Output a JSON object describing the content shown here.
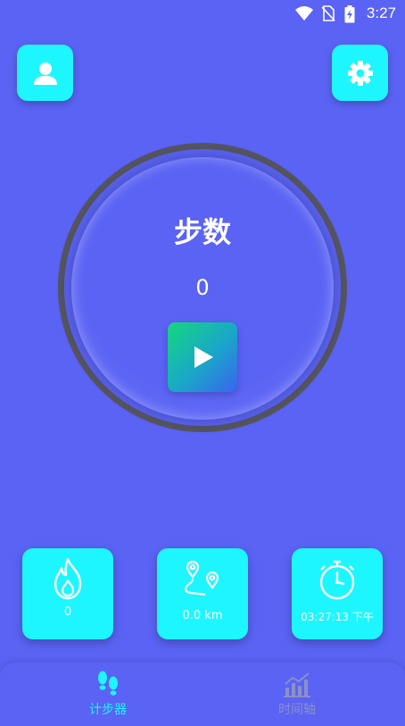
{
  "status_bar": {
    "time": "3:27"
  },
  "header": {
    "profile_icon": "person-icon",
    "settings_icon": "gear-icon"
  },
  "counter": {
    "title": "步数",
    "steps": "0",
    "play_icon": "play-icon"
  },
  "cards": {
    "calories": {
      "icon": "flame-icon",
      "value": "0"
    },
    "distance": {
      "icon": "route-pins-icon",
      "value": "0.0 km"
    },
    "clock": {
      "icon": "stopwatch-icon",
      "value": "03:27:13 下午"
    }
  },
  "bottom_nav": {
    "items": [
      {
        "label": "计步器",
        "icon": "footprints-icon",
        "active": true
      },
      {
        "label": "时间轴",
        "icon": "bar-chart-icon",
        "active": false
      }
    ]
  },
  "colors": {
    "background": "#5a63f4",
    "accent": "#1ef6ff",
    "ring": "#555561",
    "inactive": "#8a90c8"
  }
}
